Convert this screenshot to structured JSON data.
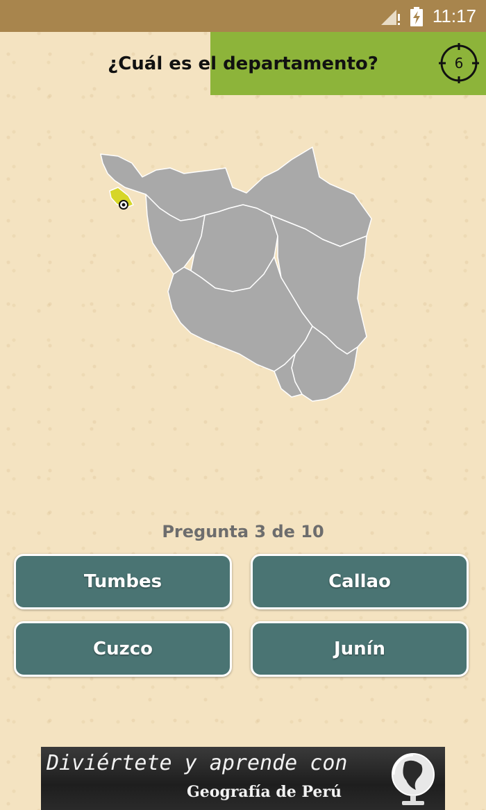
{
  "status_bar": {
    "time": "11:17",
    "icons": [
      "signal-icon",
      "battery-charging-icon"
    ]
  },
  "header": {
    "question": "¿Cuál es el departamento?",
    "timer_value": "6",
    "accent_color": "#8db43a"
  },
  "map": {
    "description_icon": "peru-map",
    "highlight_color": "#d6d629",
    "region_color": "#a9a9a9"
  },
  "quiz": {
    "progress": "Pregunta 3 de 10",
    "answers": [
      "Tumbes",
      "Callao",
      "Cuzco",
      "Junín"
    ],
    "button_color": "#4a7473"
  },
  "ad": {
    "line1": "Diviértete y aprende con",
    "line2": "Geografía de Perú"
  }
}
